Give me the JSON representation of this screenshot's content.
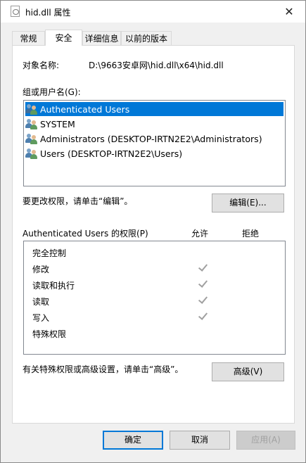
{
  "window": {
    "title": "hid.dll 属性",
    "close_glyph": "✕"
  },
  "tabs": [
    {
      "label": "常规",
      "active": false
    },
    {
      "label": "安全",
      "active": true
    },
    {
      "label": "详细信息",
      "active": false
    },
    {
      "label": "以前的版本",
      "active": false
    }
  ],
  "security": {
    "object_name_label": "对象名称:",
    "object_name_value": "D:\\9663安卓网\\hid.dll\\x64\\hid.dll",
    "group_label": "组或用户名(G):",
    "users": [
      {
        "name": "Authenticated Users",
        "icon": "users-group-icon",
        "selected": true
      },
      {
        "name": "SYSTEM",
        "icon": "users-group-icon",
        "selected": false
      },
      {
        "name": "Administrators (DESKTOP-IRTN2E2\\Administrators)",
        "icon": "users-group-icon",
        "selected": false
      },
      {
        "name": "Users (DESKTOP-IRTN2E2\\Users)",
        "icon": "users-group-icon",
        "selected": false
      }
    ],
    "edit_hint": "要更改权限，请单击“编辑”。",
    "edit_button": "编辑(E)...",
    "permissions_label": "Authenticated Users 的权限(P)",
    "allow_header": "允许",
    "deny_header": "拒绝",
    "permissions": [
      {
        "name": "完全控制",
        "allow": false,
        "deny": false
      },
      {
        "name": "修改",
        "allow": true,
        "deny": false
      },
      {
        "name": "读取和执行",
        "allow": true,
        "deny": false
      },
      {
        "name": "读取",
        "allow": true,
        "deny": false
      },
      {
        "name": "写入",
        "allow": true,
        "deny": false
      },
      {
        "name": "特殊权限",
        "allow": false,
        "deny": false
      }
    ],
    "advanced_hint": "有关特殊权限或高级设置，请单击“高级”。",
    "advanced_button": "高级(V)"
  },
  "footer": {
    "ok": "确定",
    "cancel": "取消",
    "apply": "应用(A)"
  },
  "colors": {
    "selection": "#0078d7",
    "default_button_border": "#0078d7",
    "check_mark": "#a0a0a0"
  }
}
